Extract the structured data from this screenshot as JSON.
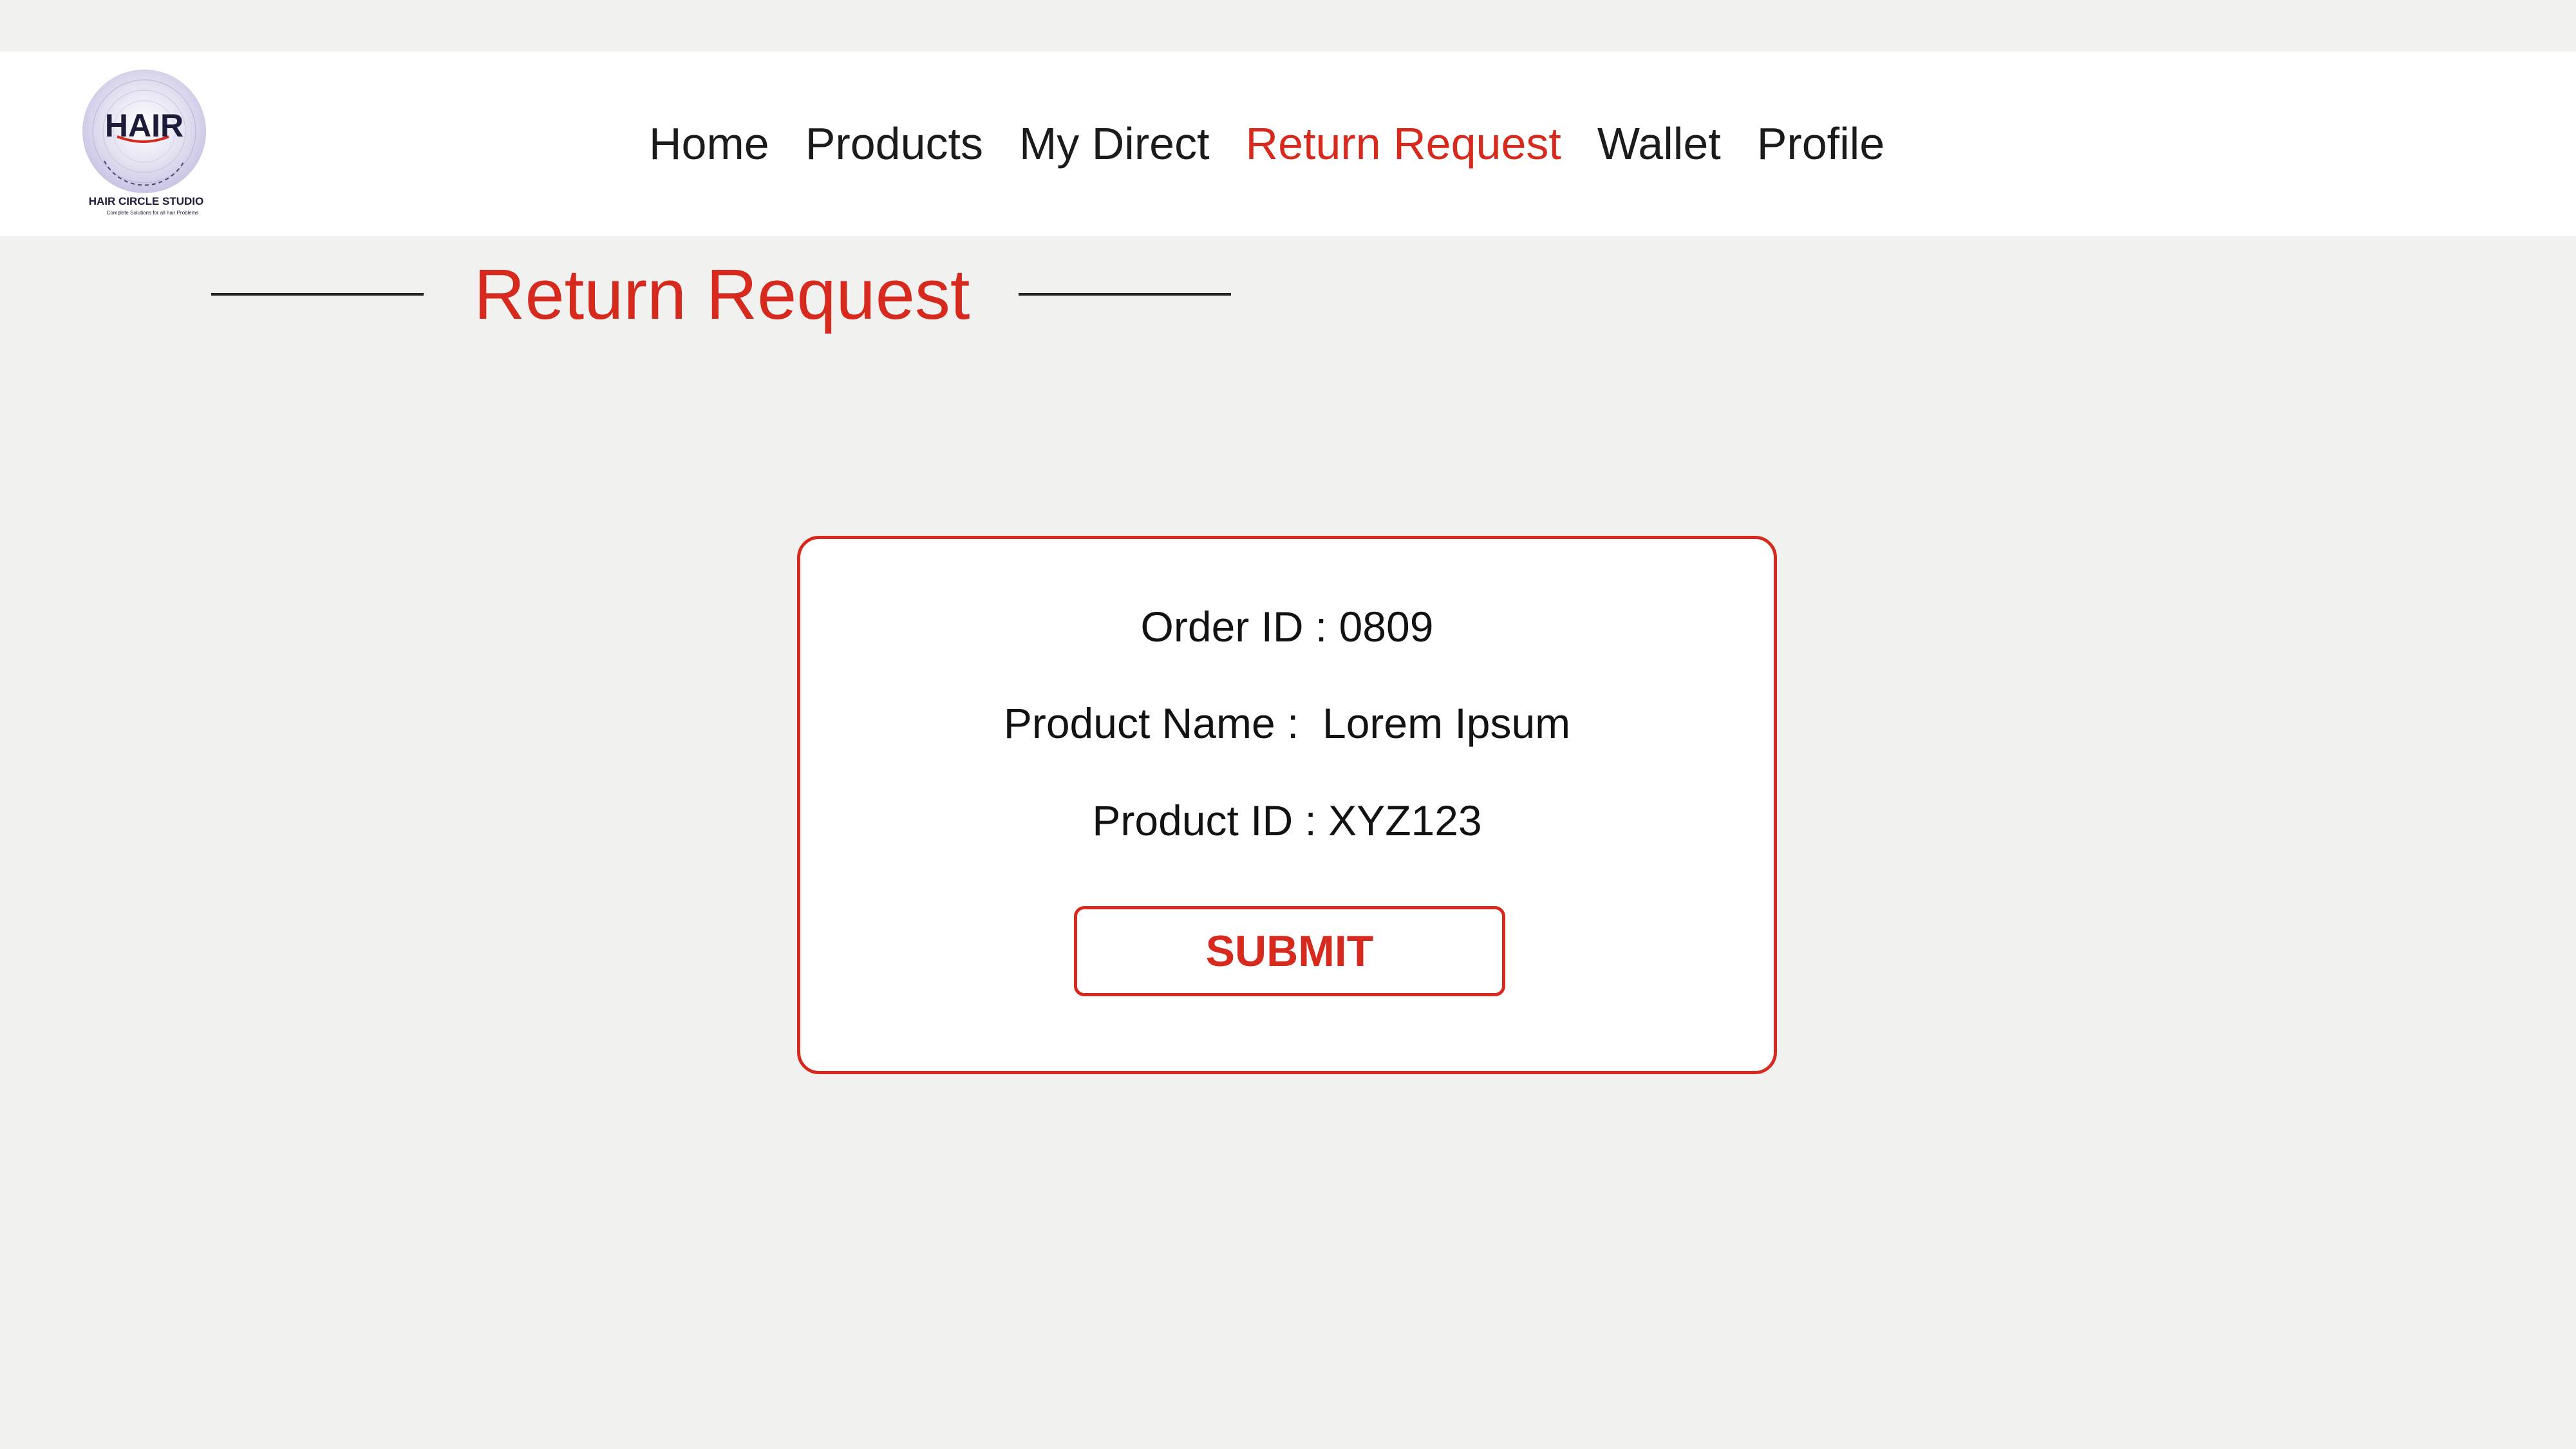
{
  "header": {
    "logo": {
      "name": "hair-circle-studio-logo",
      "wordmark": "HAIR",
      "studio_name": "HAIR CIRCLE STUDIO",
      "tagline": "Complete Solutions for all hair Problems"
    },
    "nav": [
      {
        "label": "Home",
        "active": false
      },
      {
        "label": "Products",
        "active": false
      },
      {
        "label": "My Direct",
        "active": false
      },
      {
        "label": "Return Request",
        "active": true
      },
      {
        "label": "Wallet",
        "active": false
      },
      {
        "label": "Profile",
        "active": false
      }
    ]
  },
  "page": {
    "title": "Return Request"
  },
  "return_card": {
    "order_id": "Order ID : 0809",
    "product_name": "Product Name :  Lorem Ipsum",
    "product_id": "Product ID : XYZ123",
    "submit_label": "SUBMIT"
  },
  "colors": {
    "accent": "#d62a1f",
    "background": "#f1f1ef",
    "header_bg": "#ffffff",
    "text": "#1b1b1b"
  }
}
